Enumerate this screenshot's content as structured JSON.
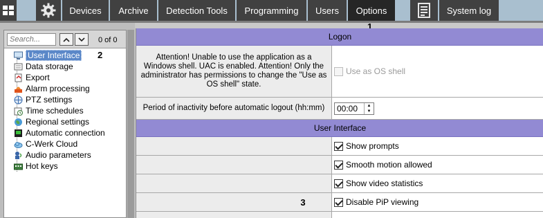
{
  "toolbar": {
    "tabs": [
      {
        "label": "Devices"
      },
      {
        "label": "Archive"
      },
      {
        "label": "Detection Tools"
      },
      {
        "label": "Programming"
      },
      {
        "label": "Users"
      },
      {
        "label": "Options",
        "active": true
      }
    ],
    "system_log_label": "System log",
    "icons": [
      "grid-icon",
      "gear-icon",
      "log-icon"
    ]
  },
  "sidebar": {
    "search_placeholder": "Search...",
    "counter": "0 of 0",
    "items": [
      {
        "label": "User Interface",
        "icon": "monitor-icon",
        "selected": true
      },
      {
        "label": "Data storage",
        "icon": "storage-icon"
      },
      {
        "label": "Export",
        "icon": "export-icon"
      },
      {
        "label": "Alarm processing",
        "icon": "alarm-icon"
      },
      {
        "label": "PTZ settings",
        "icon": "ptz-icon"
      },
      {
        "label": "Time schedules",
        "icon": "schedule-icon"
      },
      {
        "label": "Regional settings",
        "icon": "globe-icon"
      },
      {
        "label": "Automatic connection",
        "icon": "connection-icon"
      },
      {
        "label": "C-Werk Cloud",
        "icon": "cloud-icon"
      },
      {
        "label": "Audio parameters",
        "icon": "audio-icon"
      },
      {
        "label": "Hot keys",
        "icon": "hotkeys-icon"
      }
    ]
  },
  "callouts": {
    "one": "1",
    "two": "2",
    "three": "3"
  },
  "main": {
    "logon_header": "Logon",
    "attention_text": "Attention! Unable to use the application as a Windows shell. UAC is enabled. Attention! Only the administrator has permissions to change the \"Use as OS shell\" state.",
    "use_as_os_shell": "Use as OS shell",
    "inactivity_label": "Period of inactivity before automatic logout (hh:mm)",
    "inactivity_value": "00:00",
    "ui_header": "User Interface",
    "options": [
      {
        "label": "Show prompts",
        "checked": true
      },
      {
        "label": "Smooth motion allowed",
        "checked": true
      },
      {
        "label": "Show video statistics",
        "checked": true
      },
      {
        "label": "Disable PiP viewing",
        "checked": true
      }
    ]
  },
  "colors": {
    "section_header": "#928ad3",
    "topbar": "#414141",
    "selected_item": "#5a87c8"
  }
}
